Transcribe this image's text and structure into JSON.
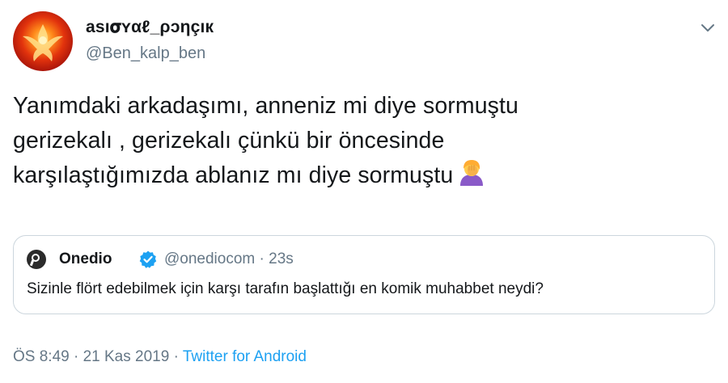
{
  "tweet": {
    "display_name": "ası𝛔ʏαℓ_ρɔηçıк",
    "username": "@Ben_kalp_ben",
    "text_line1": "Yanımdaki arkadaşımı, anneniz mi diye sormuştu",
    "text_line2": "gerizekalı , gerizekalı çünkü bir öncesinde",
    "text_line3": "karşılaştığımızda ablanız mı diye sormuştu"
  },
  "quote": {
    "name": "Onedio",
    "handle_time": "@onediocom · 23s",
    "text": "Sizinle flört edebilmek için karşı tarafın başlattığı en komik muhabbet neydi?"
  },
  "meta": {
    "time_date": "ÖS 8:49 · 21 Kas 2019 · ",
    "source": "Twitter for Android"
  },
  "icons": {
    "caret": "chevron-down-icon",
    "emoji": "woman-facepalming-emoji",
    "verified": "verified-badge-icon"
  },
  "colors": {
    "link": "#1da1f2",
    "secondary_text": "#657786",
    "border": "#ccd6dd"
  }
}
